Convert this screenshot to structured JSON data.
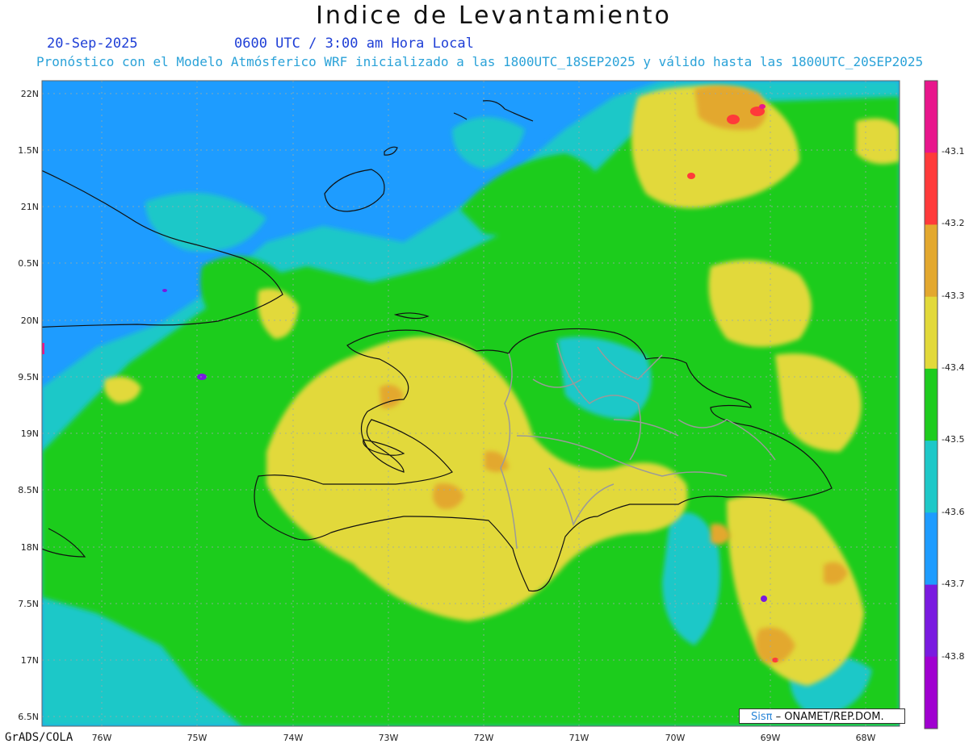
{
  "header": {
    "title": "Indice de Levantamiento",
    "date": "20-Sep-2025",
    "valid_time": "0600 UTC / 3:00 am Hora Local",
    "subtitle": "Pronóstico con el Modelo Atmósferico WRF inicializado a las 1800UTC_18SEP2025 y válido hasta las  1800UTC_20SEP2025"
  },
  "map": {
    "lon_labels": [
      "76W",
      "75W",
      "74W",
      "73W",
      "72W",
      "71W",
      "70W",
      "69W",
      "68W"
    ],
    "lat_labels": [
      "22N",
      "1.5N",
      "21N",
      "0.5N",
      "20N",
      "9.5N",
      "19N",
      "8.5N",
      "18N",
      "7.5N",
      "17N",
      "6.5N"
    ]
  },
  "colorbar": {
    "labels": [
      "-43.1",
      "-43.2",
      "-43.3",
      "-43.4",
      "-43.5",
      "-43.6",
      "-43.7",
      "-43.8"
    ],
    "colors": [
      "#e8168c",
      "#ff3a3a",
      "#e3a82e",
      "#e2d93a",
      "#1ecc1e",
      "#1ec8c8",
      "#1e9cff",
      "#7a1ae0",
      "#a000d0"
    ]
  },
  "palette": {
    "ocean_blue": "#1e9cff",
    "cyan": "#1ec8c8",
    "green": "#1ecc1e",
    "yellow": "#e2d93a",
    "orange": "#e3a82e",
    "red": "#ff3a3a",
    "magenta": "#e8168c"
  },
  "credits": {
    "left": "GrADS/COLA",
    "box_brand": "Sisπ",
    "box_text": "– ONAMET/REP.DOM."
  }
}
